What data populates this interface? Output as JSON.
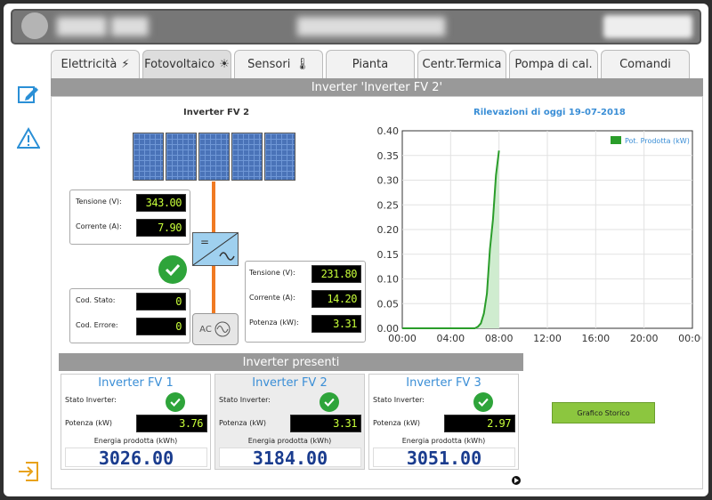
{
  "tabs": [
    {
      "label": "Elettricità",
      "icon": "lightning-icon"
    },
    {
      "label": "Fotovoltaico",
      "icon": "sun-icon"
    },
    {
      "label": "Sensori",
      "icon": "thermometer-icon"
    },
    {
      "label": "Pianta"
    },
    {
      "label": "Centr.Termica"
    },
    {
      "label": "Pompa di cal."
    },
    {
      "label": "Comandi"
    }
  ],
  "page_title": "Inverter 'Inverter FV 2'",
  "left_panel": {
    "title": "Inverter FV 2",
    "dc": {
      "voltage_label": "Tensione (V):",
      "voltage": "343.00",
      "current_label": "Corrente (A):",
      "current": "7.90"
    },
    "status": {
      "code_label": "Cod. Stato:",
      "code": "0",
      "error_label": "Cod. Errore:",
      "error": "0"
    },
    "ac": {
      "voltage_label": "Tensione (V):",
      "voltage": "231.80",
      "current_label": "Corrente (A):",
      "current": "14.20",
      "power_label": "Potenza (kW):",
      "power": "3.31"
    },
    "ac_symbol": "AC"
  },
  "chart_data": {
    "type": "area",
    "title": "Rilevazioni di oggi 19-07-2018",
    "series": [
      {
        "name": "Pot. Prodotta (kW)",
        "color": "#2a9d2a",
        "x": [
          "00:00",
          "05:00",
          "05:30",
          "05:45",
          "06:00",
          "06:15",
          "06:30",
          "06:45",
          "07:00",
          "07:15",
          "07:30",
          "07:45",
          "08:00"
        ],
        "xh": [
          0,
          5,
          5.5,
          5.75,
          6,
          6.25,
          6.5,
          6.75,
          7,
          7.25,
          7.5,
          7.75,
          8
        ],
        "values": [
          0,
          0,
          0,
          0,
          0,
          0.003,
          0.01,
          0.03,
          0.07,
          0.16,
          0.22,
          0.31,
          0.36
        ]
      }
    ],
    "xticks": [
      "00:00",
      "04:00",
      "08:00",
      "12:00",
      "16:00",
      "20:00",
      "00:00"
    ],
    "yticks": [
      "0.00",
      "0.05",
      "0.10",
      "0.15",
      "0.20",
      "0.25",
      "0.30",
      "0.35",
      "0.40"
    ],
    "ylim": [
      0,
      0.4
    ],
    "xlim_hours": [
      0,
      24
    ],
    "legend": "top-right"
  },
  "inverters_title": "Inverter presenti",
  "inverters": [
    {
      "name": "Inverter FV 1",
      "state_label": "Stato Inverter:",
      "power_label": "Potenza (kW)",
      "power": "3.76",
      "energy_label": "Energia prodotta (kWh)",
      "energy": "3026.00"
    },
    {
      "name": "Inverter FV 2",
      "state_label": "Stato Inverter:",
      "power_label": "Potenza (kW)",
      "power": "3.31",
      "energy_label": "Energia prodotta (kWh)",
      "energy": "3184.00"
    },
    {
      "name": "Inverter FV 3",
      "state_label": "Stato Inverter:",
      "power_label": "Potenza (kW)",
      "power": "2.97",
      "energy_label": "Energia prodotta (kWh)",
      "energy": "3051.00"
    }
  ],
  "history_button": "Grafico Storico"
}
